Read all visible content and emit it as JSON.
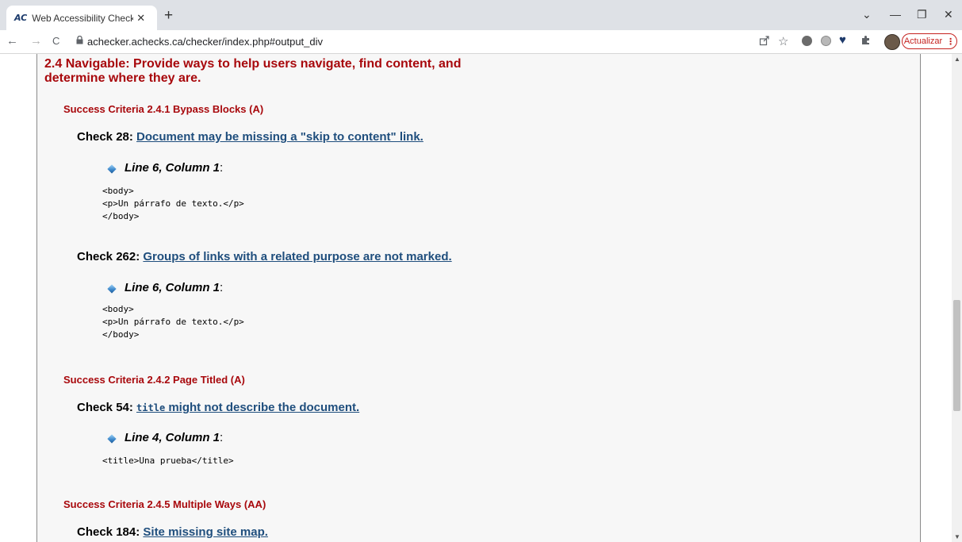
{
  "browser": {
    "tab_favicon": "AC",
    "tab_title": "Web Accessibility Checker for WC",
    "tab_close": "✕",
    "new_tab": "+",
    "window_dropdown": "⌄",
    "window_minimize": "—",
    "window_restore": "❐",
    "window_close": "✕",
    "back": "←",
    "forward": "→",
    "reload": "C",
    "url": "achecker.achecks.ca/checker/index.php#output_div",
    "update_label": "Actualizar",
    "icons": [
      "share-icon",
      "bookmark-star-icon",
      "extension-wordpress-icon",
      "extension-gray-icon",
      "extension-heart-icon",
      "extensions-puzzle-icon",
      "profile-avatar"
    ]
  },
  "guideline": {
    "title": "2.4 Navigable: Provide ways to help users navigate, find content, and",
    "title_line2": "determine where they are."
  },
  "criteria": [
    {
      "title": "Success Criteria 2.4.1 Bypass Blocks (A)",
      "checks": [
        {
          "label": "Check 28: ",
          "link": "Document may be missing a \"skip to content\" link.",
          "location": "Line 6, Column 1",
          "code": [
            "<body>",
            "<p>Un párrafo de texto.</p>",
            "</body>"
          ]
        },
        {
          "label": "Check 262: ",
          "link": "Groups of links with a related purpose are not marked.",
          "location": "Line 6, Column 1",
          "code": [
            "<body>",
            "<p>Un párrafo de texto.</p>",
            "</body>"
          ]
        }
      ]
    },
    {
      "title": "Success Criteria 2.4.2 Page Titled (A)",
      "checks": [
        {
          "label": "Check 54: ",
          "link_code": "title",
          "link": " might not describe the document.",
          "location": "Line 4, Column 1",
          "code": [
            "<title>Una prueba</title>"
          ]
        }
      ]
    },
    {
      "title": "Success Criteria 2.4.5 Multiple Ways (AA)",
      "checks": [
        {
          "label": "Check 184: ",
          "link": "Site missing site map."
        }
      ]
    }
  ],
  "colors": {
    "heading_red": "#a8080c",
    "link_blue": "#1f4e7d",
    "panel_bg": "#f7f7f7"
  }
}
